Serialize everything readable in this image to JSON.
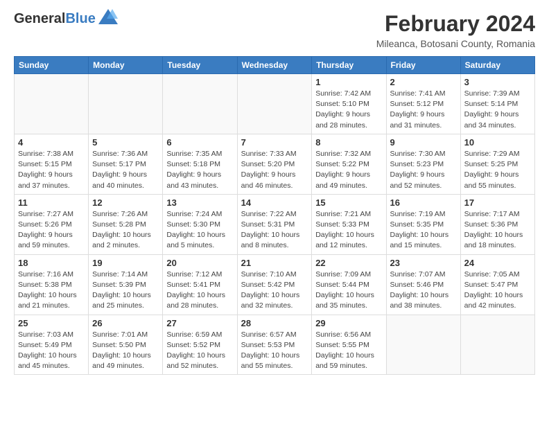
{
  "header": {
    "logo_general": "General",
    "logo_blue": "Blue",
    "month_title": "February 2024",
    "location": "Mileanca, Botosani County, Romania"
  },
  "weekdays": [
    "Sunday",
    "Monday",
    "Tuesday",
    "Wednesday",
    "Thursday",
    "Friday",
    "Saturday"
  ],
  "weeks": [
    [
      {
        "day": "",
        "info": ""
      },
      {
        "day": "",
        "info": ""
      },
      {
        "day": "",
        "info": ""
      },
      {
        "day": "",
        "info": ""
      },
      {
        "day": "1",
        "info": "Sunrise: 7:42 AM\nSunset: 5:10 PM\nDaylight: 9 hours\nand 28 minutes."
      },
      {
        "day": "2",
        "info": "Sunrise: 7:41 AM\nSunset: 5:12 PM\nDaylight: 9 hours\nand 31 minutes."
      },
      {
        "day": "3",
        "info": "Sunrise: 7:39 AM\nSunset: 5:14 PM\nDaylight: 9 hours\nand 34 minutes."
      }
    ],
    [
      {
        "day": "4",
        "info": "Sunrise: 7:38 AM\nSunset: 5:15 PM\nDaylight: 9 hours\nand 37 minutes."
      },
      {
        "day": "5",
        "info": "Sunrise: 7:36 AM\nSunset: 5:17 PM\nDaylight: 9 hours\nand 40 minutes."
      },
      {
        "day": "6",
        "info": "Sunrise: 7:35 AM\nSunset: 5:18 PM\nDaylight: 9 hours\nand 43 minutes."
      },
      {
        "day": "7",
        "info": "Sunrise: 7:33 AM\nSunset: 5:20 PM\nDaylight: 9 hours\nand 46 minutes."
      },
      {
        "day": "8",
        "info": "Sunrise: 7:32 AM\nSunset: 5:22 PM\nDaylight: 9 hours\nand 49 minutes."
      },
      {
        "day": "9",
        "info": "Sunrise: 7:30 AM\nSunset: 5:23 PM\nDaylight: 9 hours\nand 52 minutes."
      },
      {
        "day": "10",
        "info": "Sunrise: 7:29 AM\nSunset: 5:25 PM\nDaylight: 9 hours\nand 55 minutes."
      }
    ],
    [
      {
        "day": "11",
        "info": "Sunrise: 7:27 AM\nSunset: 5:26 PM\nDaylight: 9 hours\nand 59 minutes."
      },
      {
        "day": "12",
        "info": "Sunrise: 7:26 AM\nSunset: 5:28 PM\nDaylight: 10 hours\nand 2 minutes."
      },
      {
        "day": "13",
        "info": "Sunrise: 7:24 AM\nSunset: 5:30 PM\nDaylight: 10 hours\nand 5 minutes."
      },
      {
        "day": "14",
        "info": "Sunrise: 7:22 AM\nSunset: 5:31 PM\nDaylight: 10 hours\nand 8 minutes."
      },
      {
        "day": "15",
        "info": "Sunrise: 7:21 AM\nSunset: 5:33 PM\nDaylight: 10 hours\nand 12 minutes."
      },
      {
        "day": "16",
        "info": "Sunrise: 7:19 AM\nSunset: 5:35 PM\nDaylight: 10 hours\nand 15 minutes."
      },
      {
        "day": "17",
        "info": "Sunrise: 7:17 AM\nSunset: 5:36 PM\nDaylight: 10 hours\nand 18 minutes."
      }
    ],
    [
      {
        "day": "18",
        "info": "Sunrise: 7:16 AM\nSunset: 5:38 PM\nDaylight: 10 hours\nand 21 minutes."
      },
      {
        "day": "19",
        "info": "Sunrise: 7:14 AM\nSunset: 5:39 PM\nDaylight: 10 hours\nand 25 minutes."
      },
      {
        "day": "20",
        "info": "Sunrise: 7:12 AM\nSunset: 5:41 PM\nDaylight: 10 hours\nand 28 minutes."
      },
      {
        "day": "21",
        "info": "Sunrise: 7:10 AM\nSunset: 5:42 PM\nDaylight: 10 hours\nand 32 minutes."
      },
      {
        "day": "22",
        "info": "Sunrise: 7:09 AM\nSunset: 5:44 PM\nDaylight: 10 hours\nand 35 minutes."
      },
      {
        "day": "23",
        "info": "Sunrise: 7:07 AM\nSunset: 5:46 PM\nDaylight: 10 hours\nand 38 minutes."
      },
      {
        "day": "24",
        "info": "Sunrise: 7:05 AM\nSunset: 5:47 PM\nDaylight: 10 hours\nand 42 minutes."
      }
    ],
    [
      {
        "day": "25",
        "info": "Sunrise: 7:03 AM\nSunset: 5:49 PM\nDaylight: 10 hours\nand 45 minutes."
      },
      {
        "day": "26",
        "info": "Sunrise: 7:01 AM\nSunset: 5:50 PM\nDaylight: 10 hours\nand 49 minutes."
      },
      {
        "day": "27",
        "info": "Sunrise: 6:59 AM\nSunset: 5:52 PM\nDaylight: 10 hours\nand 52 minutes."
      },
      {
        "day": "28",
        "info": "Sunrise: 6:57 AM\nSunset: 5:53 PM\nDaylight: 10 hours\nand 55 minutes."
      },
      {
        "day": "29",
        "info": "Sunrise: 6:56 AM\nSunset: 5:55 PM\nDaylight: 10 hours\nand 59 minutes."
      },
      {
        "day": "",
        "info": ""
      },
      {
        "day": "",
        "info": ""
      }
    ]
  ]
}
